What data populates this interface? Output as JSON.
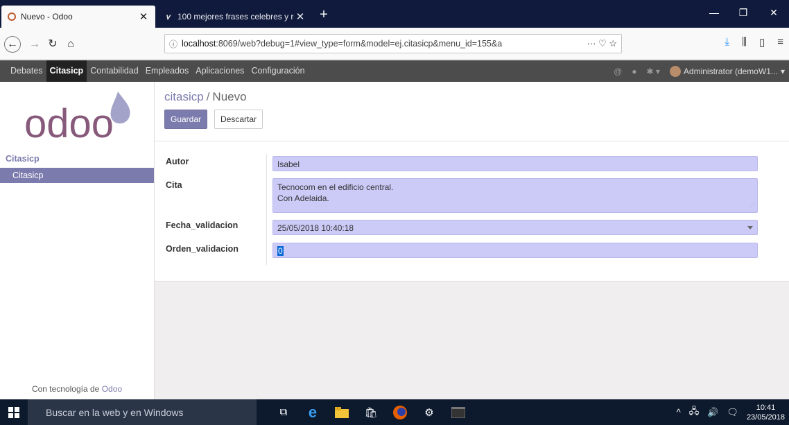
{
  "browser": {
    "tabs": [
      {
        "title": "Nuevo - Odoo",
        "active": true
      },
      {
        "title": "100 mejores frases celebres y re",
        "active": false
      }
    ],
    "new_tab": "+",
    "url_host": "localhost",
    "url_rest": ":8069/web?debug=1#view_type=form&model=ej.citasicp&menu_id=155&a",
    "url_actions": "··· ♡ ☆"
  },
  "odoo_menu": {
    "items": [
      "Debates",
      "Citasicp",
      "Contabilidad",
      "Empleados",
      "Aplicaciones",
      "Configuración"
    ],
    "active": "Citasicp",
    "user": "Administrator (demoW1..."
  },
  "sidebar": {
    "logo_text": "odoo",
    "category": "Citasicp",
    "items": [
      "Citasicp"
    ],
    "powered_prefix": "Con tecnología de ",
    "powered_brand": "Odoo"
  },
  "control": {
    "breadcrumb_parent": "citasicp",
    "breadcrumb_sep": "/",
    "breadcrumb_current": "Nuevo",
    "save_label": "Guardar",
    "discard_label": "Descartar"
  },
  "form": {
    "autor_label": "Autor",
    "autor_value": "Isabel",
    "cita_label": "Cita",
    "cita_line1": "Tecnocom en el edificio central.",
    "cita_line2": "Con Adelaida.",
    "fecha_label": "Fecha_validacion",
    "fecha_value": "25/05/2018 10:40:18",
    "orden_label": "Orden_validacion",
    "orden_value": "0"
  },
  "taskbar": {
    "search_placeholder": "Buscar en la web y en Windows",
    "time": "10:41",
    "date": "23/05/2018"
  },
  "colors": {
    "odoo_purple": "#7c7bad",
    "field_bg": "#cccbf8",
    "menu_bg": "#4c4c4c"
  }
}
